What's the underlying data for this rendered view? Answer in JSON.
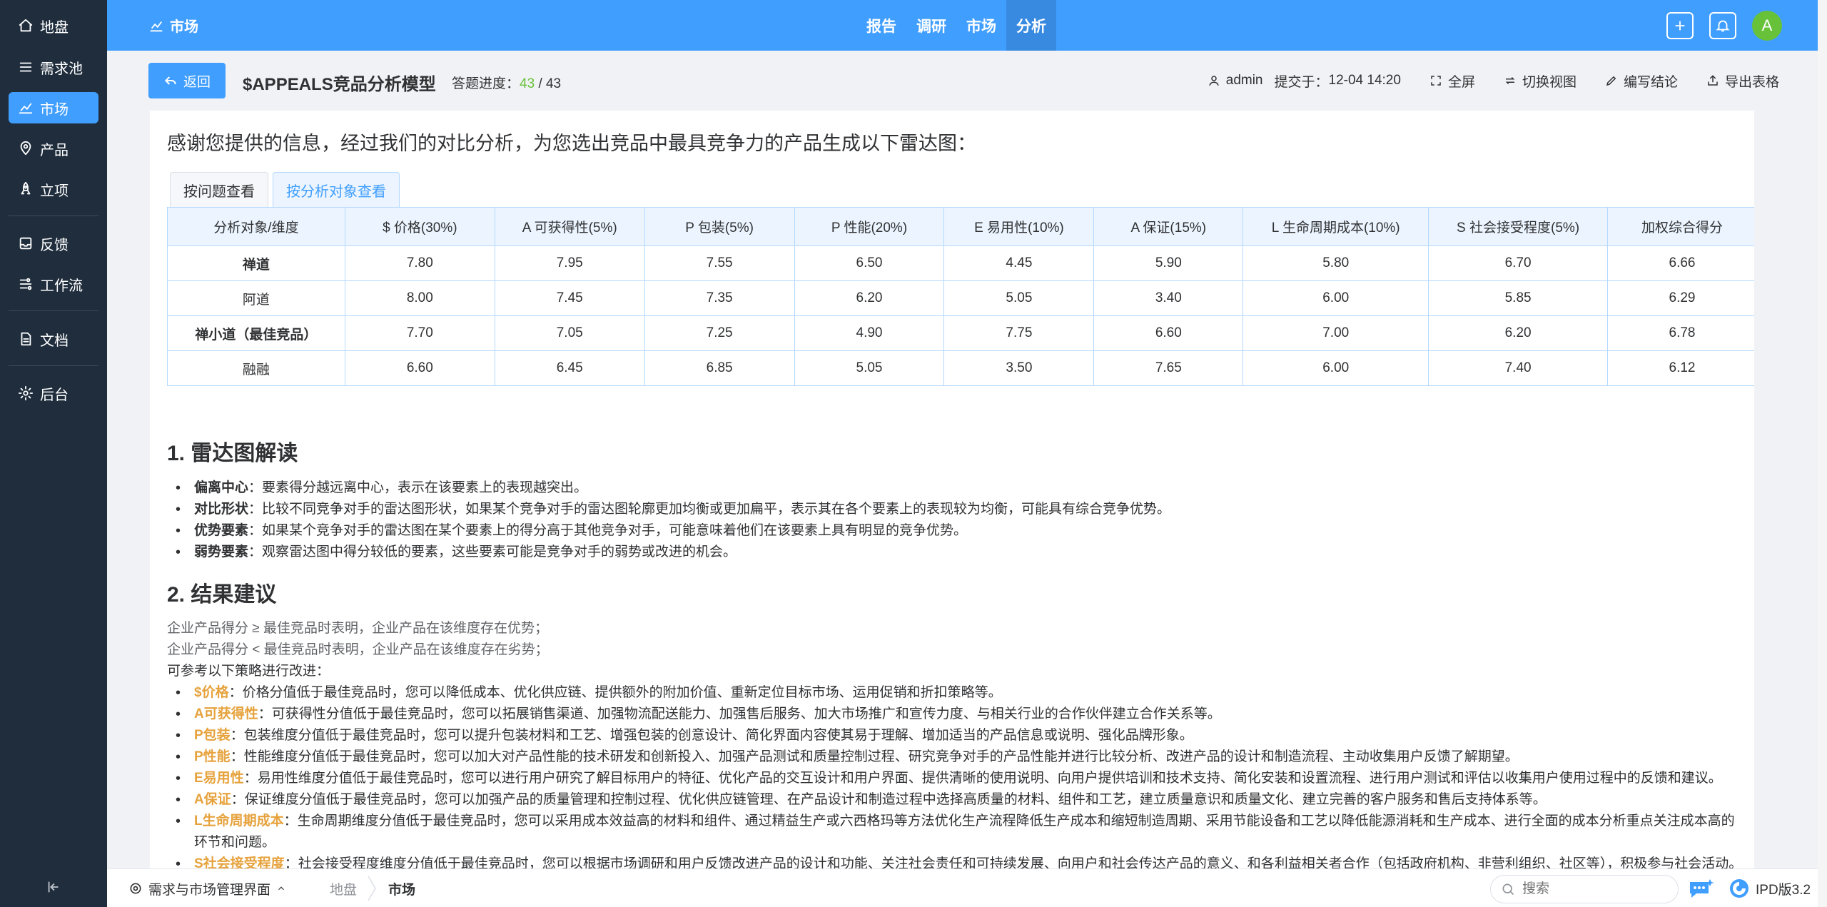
{
  "sidebar": {
    "items": [
      {
        "label": "地盘",
        "icon": "home-icon"
      },
      {
        "label": "需求池",
        "icon": "list-icon"
      },
      {
        "label": "市场",
        "icon": "chart-line-icon"
      },
      {
        "label": "产品",
        "icon": "location-pin-icon"
      },
      {
        "label": "立项",
        "icon": "rocket-icon"
      },
      {
        "label": "反馈",
        "icon": "inbox-icon"
      },
      {
        "label": "工作流",
        "icon": "workflow-icon"
      },
      {
        "label": "文档",
        "icon": "document-icon"
      },
      {
        "label": "后台",
        "icon": "gear-icon"
      }
    ]
  },
  "topbar": {
    "title": "市场",
    "nav": [
      "报告",
      "调研",
      "市场",
      "分析"
    ],
    "avatar_letter": "A",
    "accent": "#409eff"
  },
  "header": {
    "back_label": "返回",
    "model_title": "$APPEALS竞品分析模型",
    "progress_label": "答题进度：",
    "progress_done": "43",
    "progress_total": "/ 43",
    "user": "admin",
    "submitted_label": "提交于：",
    "submitted_time": "12-04 14:20",
    "actions": [
      "全屏",
      "切换视图",
      "编写结论",
      "导出表格"
    ]
  },
  "content": {
    "intro": "感谢您提供的信息，经过我们的对比分析，为您选出竞品中最具竞争力的产品生成以下雷达图：",
    "tabs": [
      "按问题查看",
      "按分析对象查看"
    ],
    "table": {
      "headers": [
        "分析对象/维度",
        "$ 价格(30%)",
        "A 可获得性(5%)",
        "P 包装(5%)",
        "P 性能(20%)",
        "E 易用性(10%)",
        "A 保证(15%)",
        "L 生命周期成本(10%)",
        "S 社会接受程度(5%)",
        "加权综合得分"
      ],
      "rows": [
        {
          "name": "禅道",
          "bold": true,
          "values": [
            "7.80",
            "7.95",
            "7.55",
            "6.50",
            "4.45",
            "5.90",
            "5.80",
            "6.70",
            "6.66"
          ]
        },
        {
          "name": "阿道",
          "bold": false,
          "values": [
            "8.00",
            "7.45",
            "7.35",
            "6.20",
            "5.05",
            "3.40",
            "6.00",
            "5.85",
            "6.29"
          ]
        },
        {
          "name": "禅小道（最佳竞品）",
          "bold": true,
          "values": [
            "7.70",
            "7.05",
            "7.25",
            "4.90",
            "7.75",
            "6.60",
            "7.00",
            "6.20",
            "6.78"
          ]
        },
        {
          "name": "融融",
          "bold": false,
          "values": [
            "6.60",
            "6.45",
            "6.85",
            "5.05",
            "3.50",
            "7.65",
            "6.00",
            "7.40",
            "6.12"
          ]
        }
      ]
    },
    "section1": {
      "title": "1. 雷达图解读",
      "bullets": [
        {
          "key": "偏离中心",
          "text": "：要素得分越远离中心，表示在该要素上的表现越突出。"
        },
        {
          "key": "对比形状",
          "text": "：比较不同竞争对手的雷达图形状，如果某个竞争对手的雷达图轮廓更加均衡或更加扁平，表示其在各个要素上的表现较为均衡，可能具有综合竞争优势。"
        },
        {
          "key": "优势要素",
          "text": "：如果某个竞争对手的雷达图在某个要素上的得分高于其他竞争对手，可能意味着他们在该要素上具有明显的竞争优势。"
        },
        {
          "key": "弱势要素",
          "text": "：观察雷达图中得分较低的要素，这些要素可能是竞争对手的弱势或改进的机会。"
        }
      ]
    },
    "section2": {
      "title": "2. 结果建议",
      "line1": "企业产品得分 ≥ 最佳竞品时表明，企业产品在该维度存在优势；",
      "line2": "企业产品得分 < 最佳竞品时表明，企业产品在该维度存在劣势；",
      "line3": "可参考以下策略进行改进：",
      "advice": [
        {
          "key": "$价格",
          "text": "：价格分值低于最佳竞品时，您可以降低成本、优化供应链、提供额外的附加价值、重新定位目标市场、运用促销和折扣策略等。"
        },
        {
          "key": "A可获得性",
          "text": "：可获得性分值低于最佳竞品时，您可以拓展销售渠道、加强物流配送能力、加强售后服务、加大市场推广和宣传力度、与相关行业的合作伙伴建立合作关系等。"
        },
        {
          "key": "P包装",
          "text": "：包装维度分值低于最佳竞品时，您可以提升包装材料和工艺、增强包装的创意设计、简化界面内容使其易于理解、增加适当的产品信息或说明、强化品牌形象。"
        },
        {
          "key": "P性能",
          "text": "：性能维度分值低于最佳竞品时，您可以加大对产品性能的技术研发和创新投入、加强产品测试和质量控制过程、研究竞争对手的产品性能并进行比较分析、改进产品的设计和制造流程、主动收集用户反馈了解期望。"
        },
        {
          "key": "E易用性",
          "text": "：易用性维度分值低于最佳竞品时，您可以进行用户研究了解目标用户的特征、优化产品的交互设计和用户界面、提供清晰的使用说明、向用户提供培训和技术支持、简化安装和设置流程、进行用户测试和评估以收集用户使用过程中的反馈和建议。"
        },
        {
          "key": "A保证",
          "text": "：保证维度分值低于最佳竞品时，您可以加强产品的质量管理和控制过程、优化供应链管理、在产品设计和制造过程中选择高质量的材料、组件和工艺，建立质量意识和质量文化、建立完善的客户服务和售后支持体系等。"
        },
        {
          "key": "L生命周期成本",
          "text": "：生命周期维度分值低于最佳竞品时，您可以采用成本效益高的材料和组件、通过精益生产或六西格玛等方法优化生产流程降低生产成本和缩短制造周期、采用节能设备和工艺以降低能源消耗和生产成本、进行全面的成本分析重点关注成本高的环节和问题。"
        },
        {
          "key": "S社会接受程度",
          "text": "：社会接受程度维度分值低于最佳竞品时，您可以根据市场调研和用户反馈改进产品的设计和功能、关注社会责任和可持续发展、向用户和社会传达产品的意义、和各利益相关者合作（包括政府机构、非营利组织、社区等），积极参与社会活动。"
        }
      ]
    }
  },
  "bottombar": {
    "app_label": "需求与市场管理界面",
    "crumbs": [
      "地盘",
      "市场"
    ],
    "search_placeholder": "搜索",
    "version": "IPD版3.2"
  }
}
